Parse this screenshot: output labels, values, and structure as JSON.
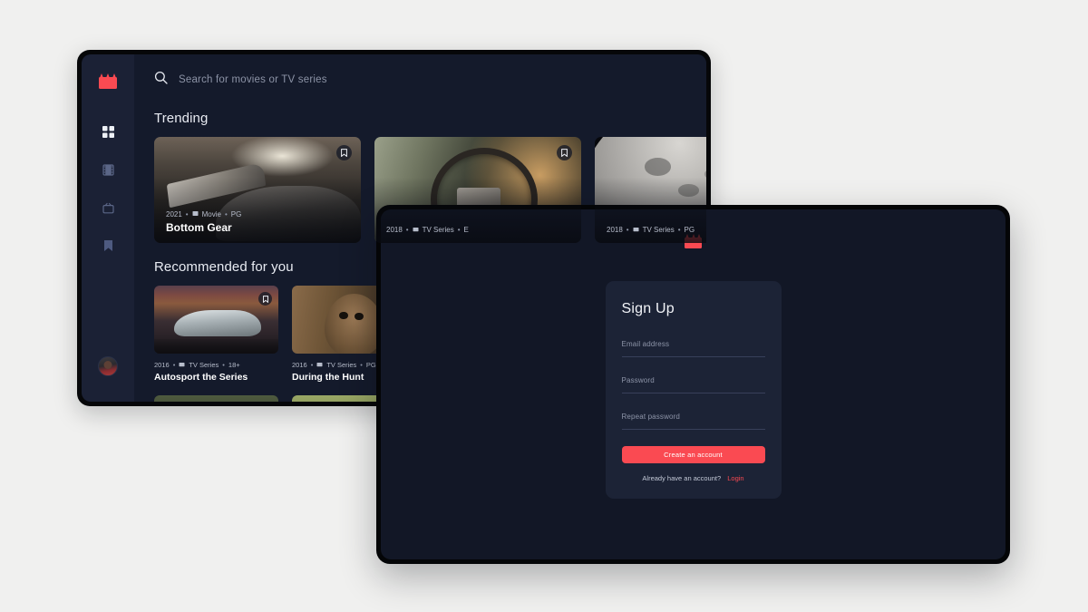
{
  "browse_window": {
    "search": {
      "icon": "search-icon",
      "placeholder": "Search for movies or TV series"
    },
    "sidebar": {
      "logo_icon": "clapperboard-logo-icon",
      "items": [
        {
          "icon": "grid-dashboard-icon",
          "name": "dashboard",
          "active": true
        },
        {
          "icon": "film-strip-icon",
          "name": "movies",
          "active": false
        },
        {
          "icon": "tv-icon",
          "name": "tv-series",
          "active": false
        },
        {
          "icon": "bookmark-icon",
          "name": "bookmarks",
          "active": false
        }
      ],
      "avatar": "user-avatar"
    },
    "sections": [
      {
        "title": "Trending",
        "cards": [
          {
            "year": "2021",
            "type_icon": "movie-icon",
            "type": "Movie",
            "rating": "PG",
            "title": "Bottom Gear",
            "art": "img-garage",
            "bookmarked": true
          },
          {
            "year": "2018",
            "type_icon": "tv-icon",
            "type": "TV Series",
            "rating": "E",
            "title": "",
            "art": "img-wheel",
            "bookmarked": true
          },
          {
            "year": "2018",
            "type_icon": "tv-icon",
            "type": "TV Series",
            "rating": "PG",
            "title": "",
            "art": "img-moon",
            "bookmarked": false
          }
        ]
      },
      {
        "title": "Recommended for you",
        "cards": [
          {
            "year": "2016",
            "type_icon": "tv-icon",
            "type": "TV Series",
            "rating": "18+",
            "title": "Autosport the Series",
            "art": "img-bmw",
            "bookmarked": true
          },
          {
            "year": "2016",
            "type_icon": "tv-icon",
            "type": "TV Series",
            "rating": "PG",
            "title": "During the Hunt",
            "art": "img-deer",
            "bookmarked": false
          }
        ]
      }
    ],
    "separator": "•"
  },
  "signup_window": {
    "logo_icon": "clapperboard-logo-icon",
    "heading": "Sign Up",
    "fields": [
      {
        "name": "email",
        "placeholder": "Email address"
      },
      {
        "name": "password",
        "placeholder": "Password"
      },
      {
        "name": "repeat-password",
        "placeholder": "Repeat password"
      }
    ],
    "submit_label": "Create an account",
    "footer_text": "Already have an account?",
    "login_label": "Login"
  },
  "colors": {
    "page_bg": "#f0f0ef",
    "window_bezel": "#060709",
    "app_bg": "#141a2b",
    "sidebar_bg": "#1b2135",
    "signup_bg": "#121726",
    "card_bg": "#1c2336",
    "accent_red": "#fa4a52",
    "text_primary": "#ffffff",
    "text_muted": "#8d94a8"
  }
}
